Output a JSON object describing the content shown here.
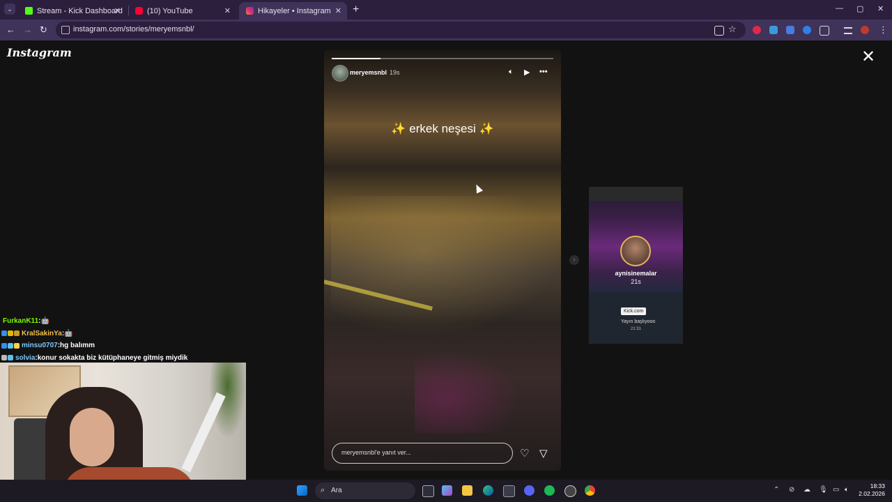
{
  "browser": {
    "tabs": [
      {
        "title": "Stream - Kick Dashboard",
        "favicon_color": "#53fc18"
      },
      {
        "title": "(10) YouTube",
        "favicon_color": "#ff0033"
      },
      {
        "title": "Hikayeler • Instagram",
        "favicon_color": "#e1306c"
      }
    ],
    "new_tab": "+",
    "url": "instagram.com/stories/meryemsnbl/",
    "window_controls": {
      "minimize": "—",
      "maximize": "▢",
      "close": "✕"
    }
  },
  "instagram": {
    "logo": "Instagram",
    "close": "✕",
    "story": {
      "username": "meryemsnbl",
      "time": "19s",
      "caption": "✨ erkek neşesi ✨",
      "progress": 0.22,
      "reply_placeholder": "meryemsnbl'e yanıt ver..."
    },
    "next_story": {
      "username": "aynisinemalar",
      "time": "21s",
      "badge": "Kick.com",
      "text1": "Yayın başlıyooo",
      "text2": "21:31"
    }
  },
  "chat": [
    {
      "name": "FurkanK11",
      "name_color": "#7cfc00",
      "sep": " :",
      "message": " 🤖"
    },
    {
      "name": "KralSakinYa",
      "name_color": "#f2c14e",
      "sep": " :",
      "message": " 🤖"
    },
    {
      "name": "minsu0707",
      "name_color": "#7ec8ff",
      "sep": " :",
      "message": " hg balımm"
    },
    {
      "name": "solvia",
      "name_color": "#7ec8ff",
      "sep": " :",
      "message": " konur sokakta biz kütüphaneye gitmiş miydik"
    }
  ],
  "taskbar": {
    "search": "Ara",
    "time": "18:33",
    "date": "2.02.2026"
  }
}
